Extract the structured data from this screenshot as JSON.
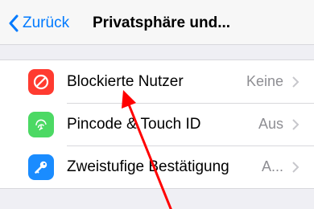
{
  "navbar": {
    "back_label": "Zurück",
    "title": "Privatsphäre und..."
  },
  "settings": {
    "items": [
      {
        "label": "Blockierte Nutzer",
        "value": "Keine",
        "icon": "blocked-icon",
        "icon_color": "#ff3b30"
      },
      {
        "label": "Pincode & Touch ID",
        "value": "Aus",
        "icon": "fingerprint-icon",
        "icon_color": "#4cd964"
      },
      {
        "label": "Zweistufige Bestätigung",
        "value": "A...",
        "icon": "key-icon",
        "icon_color": "#1a8cff"
      }
    ]
  },
  "colors": {
    "accent": "#007aff",
    "background": "#efeff4",
    "annotation_arrow": "#ff0000"
  }
}
